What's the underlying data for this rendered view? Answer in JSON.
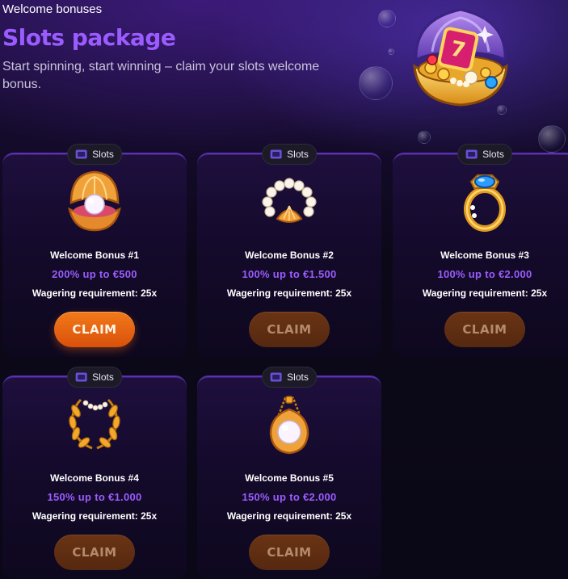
{
  "header": {
    "eyebrow": "Welcome bonuses",
    "title": "Slots package",
    "subtitle": "Start spinning, start winning – claim your slots welcome bonus."
  },
  "colors": {
    "accent": "#9b5cff",
    "claim_active": "#e8620f",
    "claim_disabled": "#5e2d12"
  },
  "cards": [
    {
      "tag": "Slots",
      "icon": "pearl-shell-icon",
      "name": "Welcome Bonus #1",
      "offer": "200% up to €500",
      "wagering": "Wagering requirement: 25x",
      "claim": "CLAIM",
      "claim_enabled": true
    },
    {
      "tag": "Slots",
      "icon": "pearl-necklace-icon",
      "name": "Welcome Bonus #2",
      "offer": "100% up to €1.500",
      "wagering": "Wagering requirement: 25x",
      "claim": "CLAIM",
      "claim_enabled": false
    },
    {
      "tag": "Slots",
      "icon": "sapphire-ring-icon",
      "name": "Welcome Bonus #3",
      "offer": "100% up to €2.000",
      "wagering": "Wagering requirement: 25x",
      "claim": "CLAIM",
      "claim_enabled": false
    },
    {
      "tag": "Slots",
      "icon": "laurel-wreath-icon",
      "name": "Welcome Bonus #4",
      "offer": "150% up to €1.000",
      "wagering": "Wagering requirement: 25x",
      "claim": "CLAIM",
      "claim_enabled": false
    },
    {
      "tag": "Slots",
      "icon": "pearl-pendant-icon",
      "name": "Welcome Bonus #5",
      "offer": "150% up to €2.000",
      "wagering": "Wagering requirement: 25x",
      "claim": "CLAIM",
      "claim_enabled": false
    }
  ]
}
